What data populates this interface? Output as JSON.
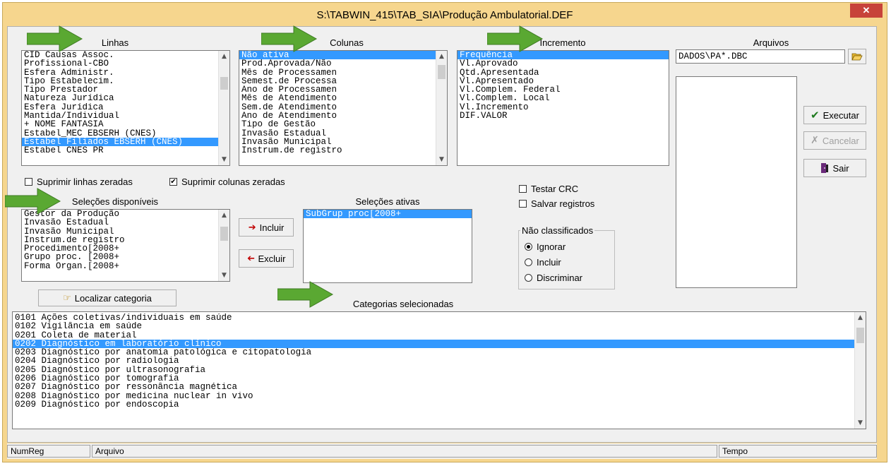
{
  "window": {
    "title": "S:\\TABWIN_415\\TAB_SIA\\Produção Ambulatorial.DEF",
    "close_label": "✕"
  },
  "headers": {
    "linhas": "Linhas",
    "colunas": "Colunas",
    "incremento": "Incremento",
    "arquivos": "Arquivos",
    "selecoes_disponiveis": "Seleções disponíveis",
    "selecoes_ativas": "Seleções ativas",
    "categorias_selecionadas": "Categorias selecionadas"
  },
  "linhas": {
    "items": [
      "CID Causas Assoc.",
      "Profissional-CBO",
      "Esfera Administr.",
      "Tipo Estabelecim.",
      "Tipo Prestador",
      "Natureza Jurídica",
      "Esfera Jurídica",
      "Mantida/Individual",
      "+ NOME FANTASIA",
      "Estabel_MEC EBSERH (CNES)",
      "Estabel Filiados EBSERH (CNES)",
      "Estabel CNES PR"
    ],
    "selected_index": 10
  },
  "colunas": {
    "items": [
      "Não ativa",
      "Prod.Aprovada/Não",
      "Mês de Processamen",
      "Semest.de Processa",
      "Ano de Processamen",
      "Mês de Atendimento",
      "Sem.de Atendimento",
      "Ano de Atendimento",
      "Tipo de Gestão",
      "Invasão Estadual",
      "Invasão Municipal",
      "Instrum.de registro"
    ],
    "selected_index": 0
  },
  "incremento": {
    "items": [
      "Frequência",
      "Vl.Aprovado",
      "Qtd.Apresentada",
      "Vl.Apresentado",
      "Vl.Complem. Federal",
      "Vl.Complem. Local",
      "Vl.Incremento",
      "DIF.VALOR"
    ],
    "selected_index": 0
  },
  "arquivos": {
    "value": "DADOS\\PA*.DBC",
    "open_icon": "folder-open-icon"
  },
  "buttons": {
    "executar": "Executar",
    "cancelar": "Cancelar",
    "sair": "Sair",
    "incluir": "Incluir",
    "excluir": "Excluir",
    "localizar": "Localizar categoria"
  },
  "checkboxes": {
    "suprimir_linhas": {
      "label": "Suprimir linhas zeradas",
      "checked": false
    },
    "suprimir_colunas": {
      "label": "Suprimir colunas zeradas",
      "checked": true
    },
    "testar_crc": {
      "label": "Testar CRC",
      "checked": false
    },
    "salvar_registros": {
      "label": "Salvar registros",
      "checked": false
    }
  },
  "selecoes_disponiveis": {
    "items": [
      "Gestor da Produção",
      "Invasão Estadual",
      "Invasão Municipal",
      "Instrum.de registro",
      "Procedimento[2008+",
      "Grupo proc. [2008+",
      "Forma Organ.[2008+"
    ]
  },
  "selecoes_ativas": {
    "items": [
      "SubGrup proc[2008+"
    ],
    "selected_index": 0
  },
  "nao_classificados": {
    "legend": "Não classificados",
    "options": [
      "Ignorar",
      "Incluir",
      "Discriminar"
    ],
    "selected_index": 0
  },
  "categorias": {
    "items": [
      "0101 Ações coletivas/individuais em saúde",
      "0102 Vigilância em saúde",
      "0201 Coleta de material",
      "0202 Diagnóstico em laboratório clínico",
      "0203 Diagnóstico por anatomia patológica e citopatologia",
      "0204 Diagnóstico por radiologia",
      "0205 Diagnóstico por ultrasonografia",
      "0206 Diagnóstico por tomografia",
      "0207 Diagnóstico por ressonância magnética",
      "0208 Diagnóstico por medicina nuclear in vivo",
      "0209 Diagnóstico por endoscopia"
    ],
    "selected_index": 3
  },
  "statusbar": {
    "numreg": "NumReg",
    "arquivo": "Arquivo",
    "tempo": "Tempo"
  },
  "colors": {
    "selection": "#3399ff",
    "window_frame": "#f6d68e",
    "close": "#c7433a",
    "arrow": "#5aa832"
  }
}
